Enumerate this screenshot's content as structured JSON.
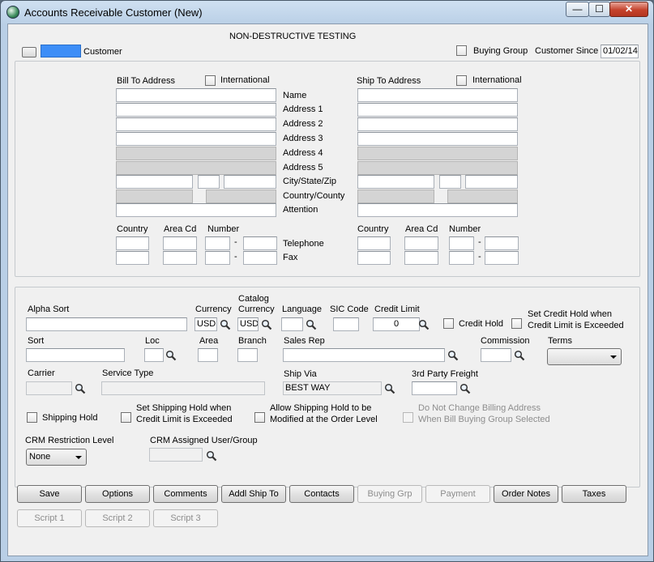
{
  "window": {
    "title": "Accounts Receivable Customer (New)",
    "min_label": "—",
    "max_label": "☐",
    "close_label": "✕"
  },
  "header": {
    "company": "NON-DESTRUCTIVE TESTING",
    "customer_label": "Customer",
    "buying_group_label": "Buying Group",
    "customer_since_label": "Customer Since",
    "customer_since_value": "01/02/14"
  },
  "address": {
    "bill_to_label": "Bill To Address",
    "ship_to_label": "Ship To Address",
    "international_label": "International",
    "row_labels": [
      "Name",
      "Address 1",
      "Address 2",
      "Address 3",
      "Address 4",
      "Address 5",
      "City/State/Zip",
      "Country/County",
      "Attention"
    ],
    "phone_cols": [
      "Country",
      "Area Cd",
      "Number"
    ],
    "telephone_label": "Telephone",
    "fax_label": "Fax",
    "dash": "-"
  },
  "details": {
    "alpha_sort_label": "Alpha Sort",
    "currency_label": "Currency",
    "currency_value": "USD",
    "catalog_currency_label_1": "Catalog",
    "catalog_currency_label_2": "Currency",
    "catalog_currency_value": "USD",
    "language_label": "Language",
    "sic_code_label": "SIC Code",
    "credit_limit_label": "Credit Limit",
    "credit_limit_value": "0",
    "credit_hold_label": "Credit Hold",
    "set_credit_hold_label_1": "Set Credit Hold when",
    "set_credit_hold_label_2": "Credit Limit is Exceeded",
    "sort_label": "Sort",
    "loc_label": "Loc",
    "area_label": "Area",
    "branch_label": "Branch",
    "sales_rep_label": "Sales Rep",
    "commission_label": "Commission",
    "terms_label": "Terms",
    "carrier_label": "Carrier",
    "service_type_label": "Service Type",
    "ship_via_label": "Ship Via",
    "ship_via_value": "BEST WAY",
    "third_party_freight_label": "3rd Party Freight",
    "shipping_hold_label": "Shipping Hold",
    "set_shipping_hold_label_1": "Set Shipping Hold when",
    "set_shipping_hold_label_2": "Credit Limit is Exceeded",
    "allow_shipping_hold_label_1": "Allow Shipping Hold to be",
    "allow_shipping_hold_label_2": "Modified at the Order Level",
    "no_change_billing_label_1": "Do Not Change Billing Address",
    "no_change_billing_label_2": "When Bill Buying Group Selected",
    "crm_restriction_label": "CRM Restriction Level",
    "crm_restriction_value": "None",
    "crm_assigned_label": "CRM Assigned User/Group"
  },
  "buttons": {
    "save": "Save",
    "options": "Options",
    "comments": "Comments",
    "addl_ship_to": "Addl Ship To",
    "contacts": "Contacts",
    "buying_grp": "Buying Grp",
    "payment": "Payment",
    "order_notes": "Order Notes",
    "taxes": "Taxes",
    "script1": "Script 1",
    "script2": "Script 2",
    "script3": "Script 3"
  },
  "icons": {
    "app": "app-globe-icon",
    "lookup": "magnifier-icon"
  }
}
